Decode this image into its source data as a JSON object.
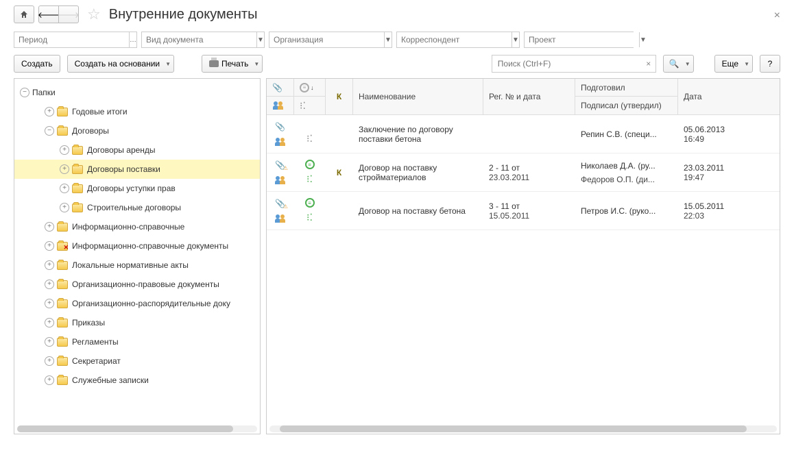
{
  "title": "Внутренние документы",
  "filters": {
    "period": "Период",
    "doc_type": "Вид документа",
    "organization": "Организация",
    "correspondent": "Корреспондент",
    "project": "Проект"
  },
  "toolbar": {
    "create": "Создать",
    "create_based": "Создать на основании",
    "print": "Печать",
    "search_ph": "Поиск (Ctrl+F)",
    "more": "Еще",
    "help": "?"
  },
  "tree": {
    "root": "Папки",
    "items": [
      {
        "label": "Годовые итоги",
        "level": 1,
        "children": true
      },
      {
        "label": "Договоры",
        "level": 1,
        "children": true,
        "expanded": true
      },
      {
        "label": "Договоры аренды",
        "level": 2,
        "children": true
      },
      {
        "label": "Договоры поставки",
        "level": 2,
        "children": true,
        "selected": true
      },
      {
        "label": "Договоры уступки прав",
        "level": 2,
        "children": true
      },
      {
        "label": "Строительные договоры",
        "level": 2,
        "children": true
      },
      {
        "label": "Информационно-справочные",
        "level": 1,
        "children": true
      },
      {
        "label": "Информационно-справочные документы",
        "level": 1,
        "children": true,
        "red": true
      },
      {
        "label": "Локальные нормативные акты",
        "level": 1,
        "children": true
      },
      {
        "label": "Организационно-правовые документы",
        "level": 1,
        "children": true
      },
      {
        "label": "Организационно-распорядительные доку",
        "level": 1,
        "children": true
      },
      {
        "label": "Приказы",
        "level": 1,
        "children": true
      },
      {
        "label": "Регламенты",
        "level": 1,
        "children": true
      },
      {
        "label": "Секретариат",
        "level": 1,
        "children": true
      },
      {
        "label": "Служебные записки",
        "level": 1,
        "children": true
      }
    ]
  },
  "grid": {
    "headers": {
      "k": "К",
      "name": "Наименование",
      "regno": "Рег. № и дата",
      "prepared": "Подготовил",
      "signed": "Подписал (утвердил)",
      "date": "Дата"
    },
    "rows": [
      {
        "attach": "clip",
        "status": "",
        "k": "",
        "name": "Заключение по договору поставки бетона",
        "regno": "",
        "prepared": "Репин С.В. (специ...",
        "signed": "",
        "date": "05.06.2013",
        "time": "16:49"
      },
      {
        "attach": "clip-warn",
        "status": "green",
        "k": "К",
        "name": "Договор на поставку стройматериалов",
        "regno": "2 - 11 от 23.03.2011",
        "prepared": "Николаев Д.А. (ру...",
        "signed": "Федоров О.П. (ди...",
        "date": "23.03.2011",
        "time": "19:47"
      },
      {
        "attach": "clip-warn",
        "status": "green",
        "k": "",
        "name": "Договор на поставку бетона",
        "regno": "3 - 11 от 15.05.2011",
        "prepared": "Петров И.С. (руко...",
        "signed": "",
        "date": "15.05.2011",
        "time": "22:03"
      }
    ]
  }
}
